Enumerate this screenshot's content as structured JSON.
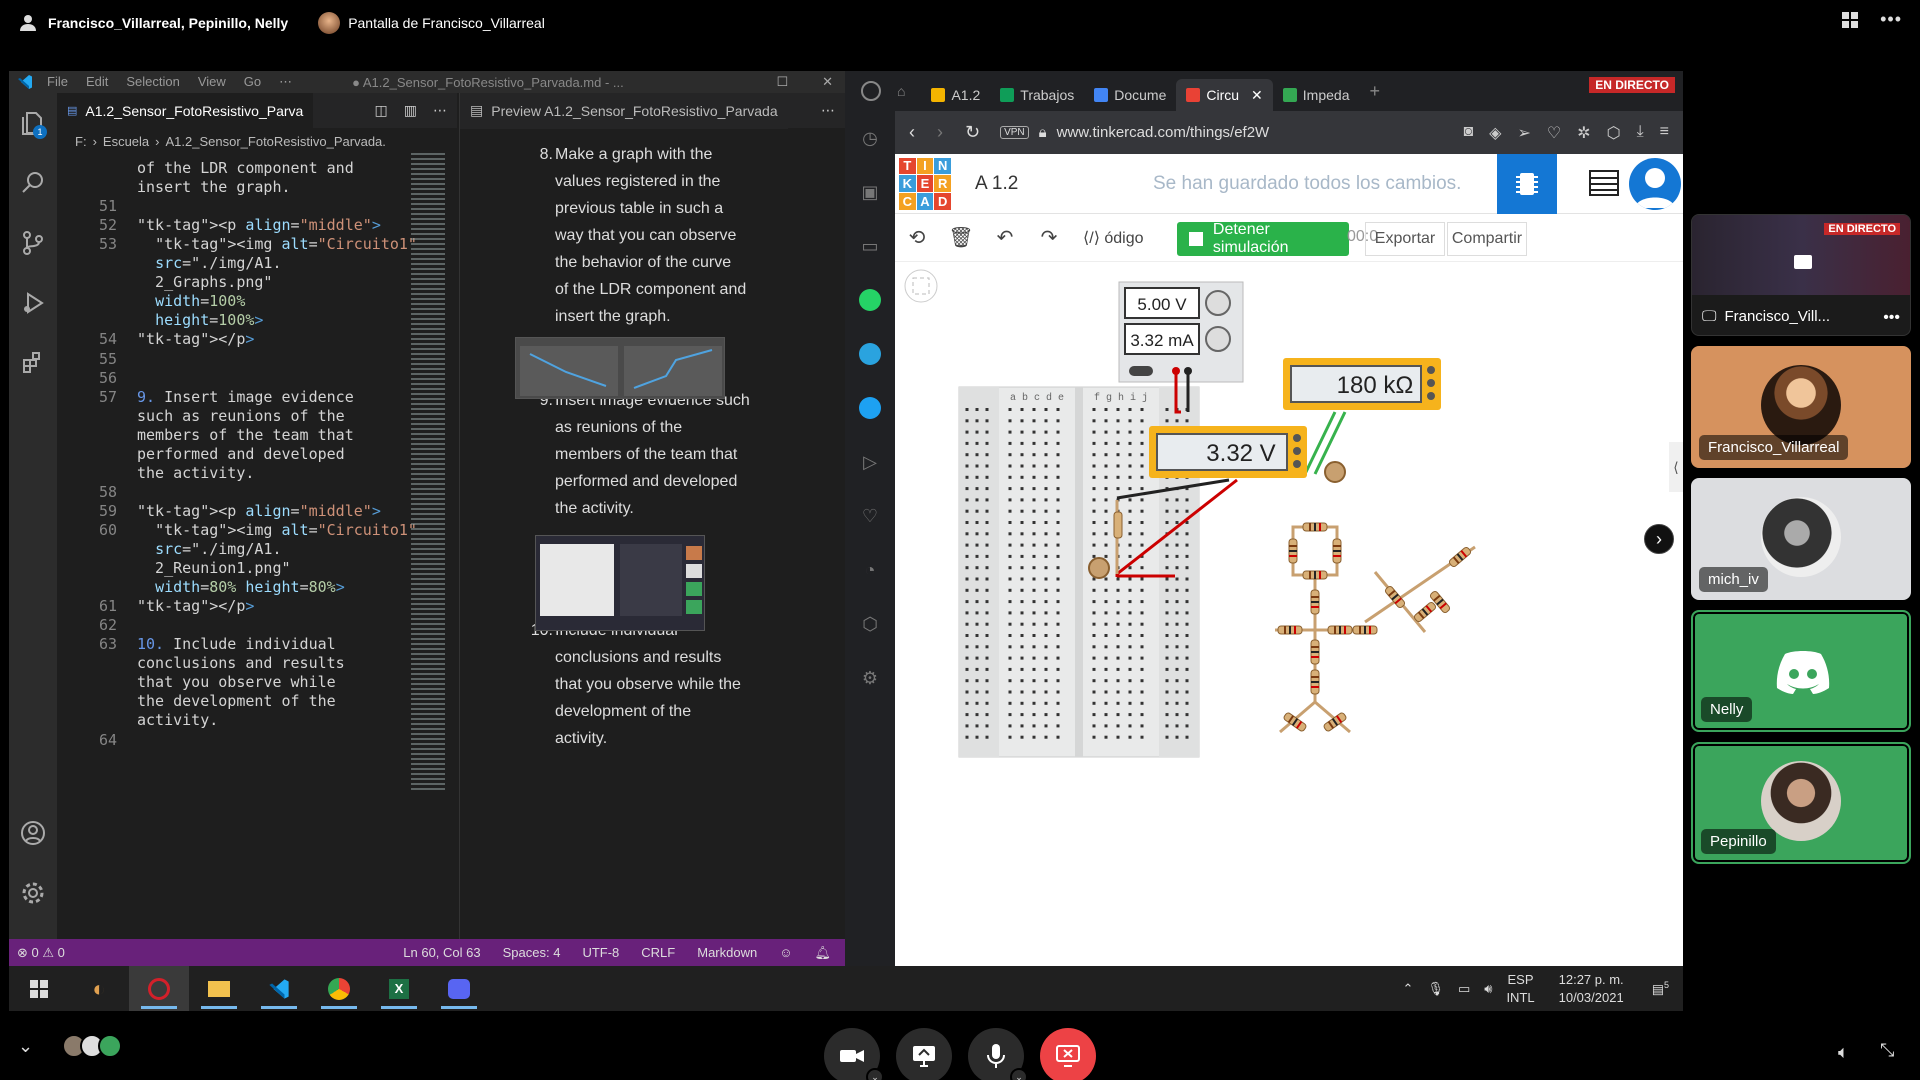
{
  "call": {
    "participants_title": "Francisco_Villarreal, Pepinillo, Nelly",
    "sharing_label": "Pantalla de Francisco_Villarreal"
  },
  "vscode": {
    "menu": [
      "File",
      "Edit",
      "Selection",
      "View",
      "Go",
      "⋯"
    ],
    "window_title": "● A1.2_Sensor_FotoResistivo_Parvada.md - ...",
    "editor_tab": "A1.2_Sensor_FotoResistivo_Parva",
    "breadcrumb": [
      "F:",
      "Escuela",
      "A1.2_Sensor_FotoResistivo_Parvada."
    ],
    "explorer_badge": "1",
    "code_lines": [
      {
        "ln": "",
        "text": "of the LDR component and"
      },
      {
        "ln": "",
        "text": "insert the graph."
      },
      {
        "ln": "51",
        "text": ""
      },
      {
        "ln": "52",
        "text": "<p align=\"middle\">"
      },
      {
        "ln": "53",
        "text": "  <img alt=\"Circuito1\""
      },
      {
        "ln": "",
        "text": "  src=\"./img/A1."
      },
      {
        "ln": "",
        "text": "  2_Graphs.png\""
      },
      {
        "ln": "",
        "text": "  width=100%"
      },
      {
        "ln": "",
        "text": "  height=100%>"
      },
      {
        "ln": "54",
        "text": "</p>"
      },
      {
        "ln": "55",
        "text": ""
      },
      {
        "ln": "56",
        "text": ""
      },
      {
        "ln": "57",
        "text": "9. Insert image evidence"
      },
      {
        "ln": "",
        "text": "such as reunions of the"
      },
      {
        "ln": "",
        "text": "members of the team that"
      },
      {
        "ln": "",
        "text": "performed and developed"
      },
      {
        "ln": "",
        "text": "the activity."
      },
      {
        "ln": "58",
        "text": ""
      },
      {
        "ln": "59",
        "text": "<p align=\"middle\">"
      },
      {
        "ln": "60",
        "text": "  <img alt=\"Circuito1\""
      },
      {
        "ln": "",
        "text": "  src=\"./img/A1."
      },
      {
        "ln": "",
        "text": "  2_Reunion1.png\""
      },
      {
        "ln": "",
        "text": "  width=80% height=80%>"
      },
      {
        "ln": "61",
        "text": "</p>"
      },
      {
        "ln": "62",
        "text": ""
      },
      {
        "ln": "63",
        "text": "10. Include individual"
      },
      {
        "ln": "",
        "text": "conclusions and results"
      },
      {
        "ln": "",
        "text": "that you observe while"
      },
      {
        "ln": "",
        "text": "the development of the"
      },
      {
        "ln": "",
        "text": "activity."
      },
      {
        "ln": "64",
        "text": ""
      }
    ],
    "preview_tab": "Preview A1.2_Sensor_FotoResistivo_Parvada",
    "preview_items": [
      {
        "num": "8.",
        "lines": [
          "Make a graph with the",
          "values registered in the",
          "previous table in such a",
          "way that you can observe",
          "the behavior of the curve",
          "of the LDR component and",
          "insert the graph."
        ]
      },
      {
        "num": "9.",
        "lines": [
          "Insert image evidence such",
          "as reunions of the",
          "members of the team that",
          "performed and developed",
          "the activity."
        ]
      },
      {
        "num": "10.",
        "lines": [
          "Include individual",
          "conclusions and results",
          "that you observe while the",
          "development of the",
          "activity."
        ]
      }
    ],
    "status": {
      "problems": "⊗ 0 ⚠ 0",
      "position": "Ln 60, Col 63",
      "spaces": "Spaces: 4",
      "encoding": "UTF-8",
      "eol": "CRLF",
      "language": "Markdown"
    }
  },
  "browser": {
    "tabs": [
      {
        "label": "A1.2",
        "color": "#f4b400"
      },
      {
        "label": "Trabajos",
        "color": "#0f9d58"
      },
      {
        "label": "Docume",
        "color": "#4285f4"
      },
      {
        "label": "Circu",
        "color": "#e94235"
      },
      {
        "label": "Impeda",
        "color": "#34a853"
      }
    ],
    "live_badge": "EN DIRECTO",
    "vpn": "VPN",
    "url": "www.tinkercad.com/things/ef2W",
    "tinkercad": {
      "logo_letters": [
        "T",
        "I",
        "N",
        "K",
        "E",
        "R",
        "C",
        "A",
        "D"
      ],
      "logo_colors": [
        "#e5462e",
        "#f4a121",
        "#3a9ddb",
        "#3a9ddb",
        "#e5462e",
        "#f4a121",
        "#f4a121",
        "#3a9ddb",
        "#e5462e"
      ],
      "project_title": "A 1.2",
      "saved_status": "Se han guardado todos los cambios.",
      "code_label": "ódigo",
      "sim_button": "Detener simulación",
      "timer": "00:0",
      "export_button": "Exportar",
      "share_button": "Compartir",
      "supply_voltage": "5.00 V",
      "supply_current": "3.32 mA",
      "ohmmeter_reading": "180 kΩ",
      "voltmeter_reading": "3.32 V",
      "breadboard_cols_left": "a b c d e",
      "breadboard_cols_right": "f g h i j"
    }
  },
  "taskbar": {
    "lang_top": "ESP",
    "lang_bottom": "INTL",
    "time": "12:27 p. m.",
    "date": "10/03/2021",
    "notif_count": "5"
  },
  "participants": [
    {
      "name": "Francisco_Vill...",
      "kind": "screen"
    },
    {
      "name": "Francisco_Villarreal",
      "kind": "avatar",
      "bg": "#d6925e"
    },
    {
      "name": "mich_iv",
      "kind": "avatar",
      "bg": "#dcdde0"
    },
    {
      "name": "Nelly",
      "kind": "discord",
      "bg": "#3ba55c"
    },
    {
      "name": "Pepinillo",
      "kind": "avatar",
      "bg": "#3ba55c"
    }
  ],
  "colors": {
    "discord_green": "#3ba55c",
    "end_call_red": "#ed4245",
    "vscode_status": "#68217a",
    "tinkercad_green": "#2ab24a"
  }
}
